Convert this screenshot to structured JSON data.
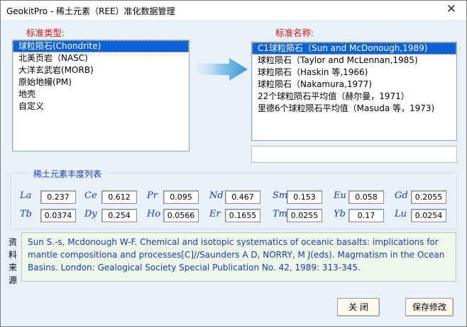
{
  "window": {
    "title": "GeokitPro - 稀土元素（REE）准化数据管理"
  },
  "left": {
    "label": "标准类型:",
    "items": [
      {
        "label": "球粒陨石(Chondrite)",
        "selected": true
      },
      {
        "label": "北美页岩（NASC)",
        "selected": false
      },
      {
        "label": "大洋玄武岩(MORB)",
        "selected": false
      },
      {
        "label": "原始地幔(PM)",
        "selected": false
      },
      {
        "label": "地壳",
        "selected": false
      },
      {
        "label": "自定义",
        "selected": false
      }
    ]
  },
  "right": {
    "label": "标准名称:",
    "items": [
      {
        "label": "C1球粒陨石（Sun and McDonough,1989)",
        "selected": true
      },
      {
        "label": "球粒陨石（Taylor and McLennan,1985)",
        "selected": false
      },
      {
        "label": "球粒陨石（Haskin 等,1966)",
        "selected": false
      },
      {
        "label": "球粒陨石（Nakamura,1977)",
        "selected": false
      },
      {
        "label": "22个球粒陨石平均值（赫尔曼，1971）",
        "selected": false
      },
      {
        "label": "里德6个球粒陨石平均值（Masuda 等，1973)",
        "selected": false
      }
    ],
    "name_input": ""
  },
  "ree": {
    "title": "稀土元素丰度列表",
    "elements": [
      {
        "symbol": "La",
        "value": "0.237"
      },
      {
        "symbol": "Ce",
        "value": "0.612"
      },
      {
        "symbol": "Pr",
        "value": "0.095"
      },
      {
        "symbol": "Nd",
        "value": "0.467"
      },
      {
        "symbol": "Sm",
        "value": "0.153"
      },
      {
        "symbol": "Eu",
        "value": "0.058"
      },
      {
        "symbol": "Gd",
        "value": "0.2055"
      },
      {
        "symbol": "Tb",
        "value": "0.0374"
      },
      {
        "symbol": "Dy",
        "value": "0.254"
      },
      {
        "symbol": "Ho",
        "value": "0.0566"
      },
      {
        "symbol": "Er",
        "value": "0.1655"
      },
      {
        "symbol": "Tm",
        "value": "0.0255"
      },
      {
        "symbol": "Yb",
        "value": "0.17"
      },
      {
        "symbol": "Lu",
        "value": "0.0254"
      }
    ]
  },
  "source": {
    "label": "资料来源",
    "text": "Sun S.-s, Mcdonough W-F. Chemical and isotopic systematics of oceanic basalts: implications for mantle compositiona and processes[C]//Saunders  A D, NORRY, M J(eds). Magmatism in the Ocean Basins. London: Gealogical Society Special Publication No. 42, 1989: 313-345."
  },
  "buttons": {
    "close": "关 闭",
    "save": "保存修改"
  },
  "colors": {
    "accent_red": "#e01010",
    "label_blue": "#1a3ab5",
    "selection": "#0a62d6",
    "arrow": "#4aa0d8"
  }
}
